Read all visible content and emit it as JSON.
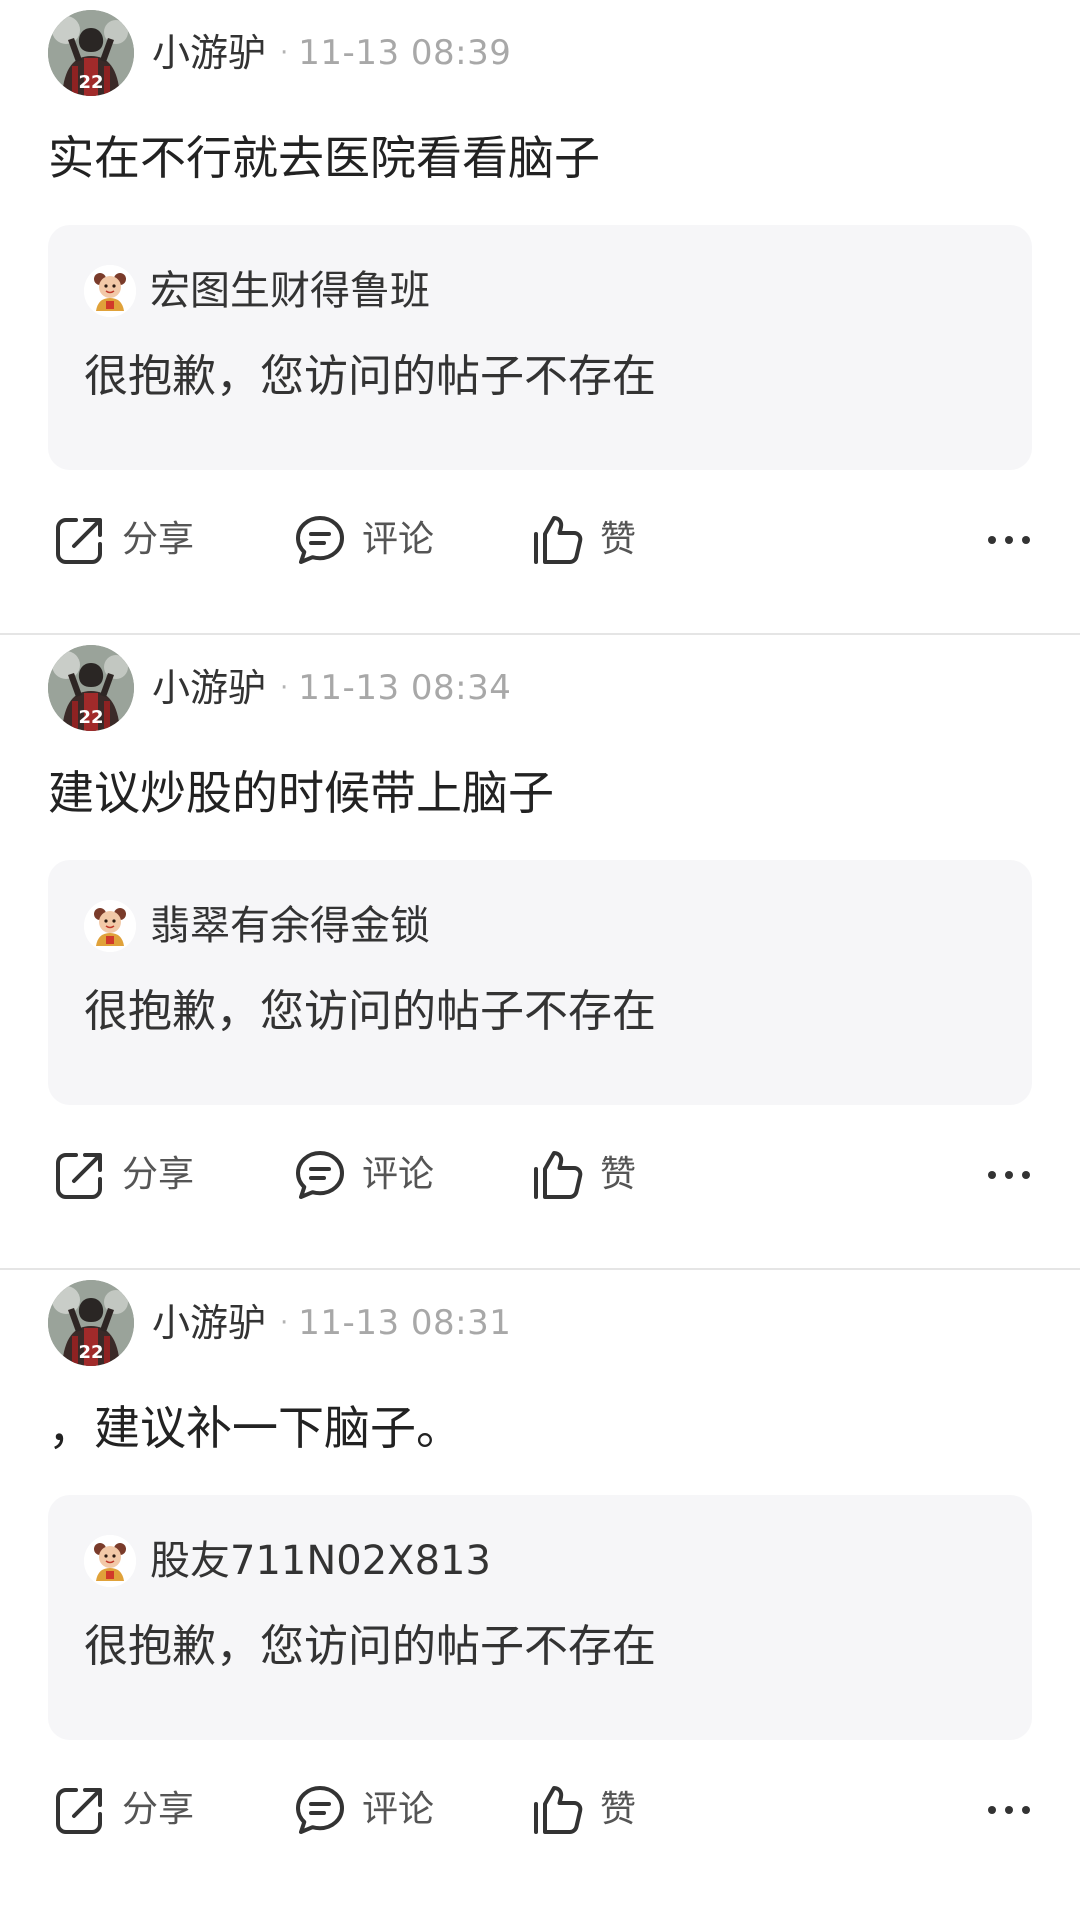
{
  "posts": [
    {
      "author": "小游驴",
      "separator": "·",
      "time": "11-13 08:39",
      "content": "实在不行就去医院看看脑子",
      "quote": {
        "author": "宏图生财得鲁班",
        "text": "很抱歉，您访问的帖子不存在"
      },
      "actions": {
        "share": "分享",
        "comment": "评论",
        "like": "赞"
      }
    },
    {
      "author": "小游驴",
      "separator": "·",
      "time": "11-13 08:34",
      "content": "建议炒股的时候带上脑子",
      "quote": {
        "author": "翡翠有余得金锁",
        "text": "很抱歉，您访问的帖子不存在"
      },
      "actions": {
        "share": "分享",
        "comment": "评论",
        "like": "赞"
      }
    },
    {
      "author": "小游驴",
      "separator": "·",
      "time": "11-13 08:31",
      "content": "，建议补一下脑子。",
      "quote": {
        "author": "股友711N02X813",
        "text": "很抱歉，您访问的帖子不存在"
      },
      "actions": {
        "share": "分享",
        "comment": "评论",
        "like": "赞"
      }
    }
  ],
  "icons": {
    "share": "share-icon",
    "comment": "comment-icon",
    "like": "thumbs-up-icon",
    "more": "more-icon"
  },
  "colors": {
    "card_background": "#f6f6f8",
    "divider": "#e5e5e5",
    "secondary_text": "#a8a8a8",
    "icon_stroke": "#333333"
  }
}
